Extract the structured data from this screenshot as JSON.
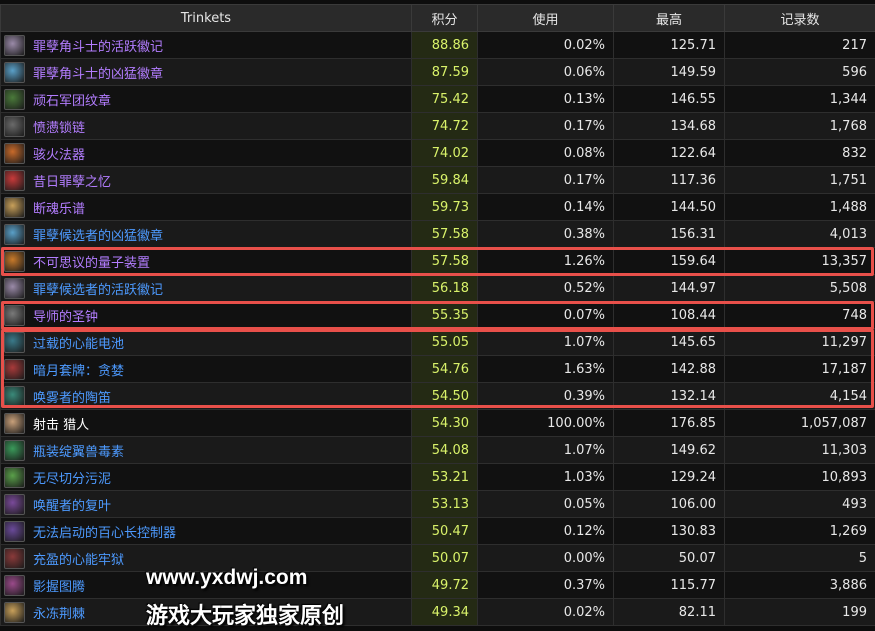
{
  "headers": [
    "Trinkets",
    "积分",
    "使用",
    "最高",
    "记录数"
  ],
  "rows": [
    {
      "name": "罪孽角斗士的活跃徽记",
      "score": "88.86",
      "usage": "0.02%",
      "max": "125.71",
      "records": "217",
      "color": "purple",
      "icon": "gladiator-emblem-icon",
      "icon_color": "#9a8aa8"
    },
    {
      "name": "罪孽角斗士的凶猛徽章",
      "score": "87.59",
      "usage": "0.06%",
      "max": "149.59",
      "records": "596",
      "color": "purple",
      "icon": "gladiator-badge-icon",
      "icon_color": "#5aa0c8"
    },
    {
      "name": "顽石军团纹章",
      "score": "75.42",
      "usage": "0.13%",
      "max": "146.55",
      "records": "1,344",
      "color": "purple",
      "icon": "stone-legion-icon",
      "icon_color": "#4a7a3a"
    },
    {
      "name": "愤懑锁链",
      "score": "74.72",
      "usage": "0.17%",
      "max": "134.68",
      "records": "1,768",
      "color": "purple",
      "icon": "chain-icon",
      "icon_color": "#6a6a6a"
    },
    {
      "name": "骇火法器",
      "score": "74.02",
      "usage": "0.08%",
      "max": "122.64",
      "records": "832",
      "color": "purple",
      "icon": "fire-relic-icon",
      "icon_color": "#c86a2a"
    },
    {
      "name": "昔日罪孽之忆",
      "score": "59.84",
      "usage": "0.17%",
      "max": "117.36",
      "records": "1,751",
      "color": "purple",
      "icon": "memory-icon",
      "icon_color": "#c83a3a"
    },
    {
      "name": "断魂乐谱",
      "score": "59.73",
      "usage": "0.14%",
      "max": "144.50",
      "records": "1,488",
      "color": "purple",
      "icon": "music-sheet-icon",
      "icon_color": "#c8a05a"
    },
    {
      "name": "罪孽候选者的凶猛徽章",
      "score": "57.58",
      "usage": "0.38%",
      "max": "156.31",
      "records": "4,013",
      "color": "blue",
      "icon": "aspirant-badge-icon",
      "icon_color": "#5aa0c8"
    },
    {
      "name": "不可思议的量子装置",
      "score": "57.58",
      "usage": "1.26%",
      "max": "159.64",
      "records": "13,357",
      "color": "purple",
      "icon": "quantum-device-icon",
      "icon_color": "#c87a2a"
    },
    {
      "name": "罪孽候选者的活跃徽记",
      "score": "56.18",
      "usage": "0.52%",
      "max": "144.97",
      "records": "5,508",
      "color": "blue",
      "icon": "aspirant-emblem-icon",
      "icon_color": "#9a8aa8"
    },
    {
      "name": "导师的圣钟",
      "score": "55.35",
      "usage": "0.07%",
      "max": "108.44",
      "records": "748",
      "color": "purple",
      "icon": "bell-icon",
      "icon_color": "#7a7a7a"
    },
    {
      "name": "过载的心能电池",
      "score": "55.05",
      "usage": "1.07%",
      "max": "145.65",
      "records": "11,297",
      "color": "blue",
      "icon": "anima-battery-icon",
      "icon_color": "#3a7a8a"
    },
    {
      "name": "暗月套牌：贪婪",
      "score": "54.76",
      "usage": "1.63%",
      "max": "142.88",
      "records": "17,187",
      "color": "blue",
      "icon": "darkmoon-deck-icon",
      "icon_color": "#a83a3a"
    },
    {
      "name": "唤雾者的陶笛",
      "score": "54.50",
      "usage": "0.39%",
      "max": "132.14",
      "records": "4,154",
      "color": "blue",
      "icon": "ocarina-icon",
      "icon_color": "#3a8a7a"
    },
    {
      "name": "射击 猎人",
      "score": "54.30",
      "usage": "100.00%",
      "max": "176.85",
      "records": "1,057,087",
      "color": "white",
      "icon": "hunter-icon",
      "icon_color": "#c8a07a"
    },
    {
      "name": "瓶装绽翼兽毒素",
      "score": "54.08",
      "usage": "1.07%",
      "max": "149.62",
      "records": "11,303",
      "color": "blue",
      "icon": "venom-bottle-icon",
      "icon_color": "#3a9a5a"
    },
    {
      "name": "无尽切分污泥",
      "score": "53.21",
      "usage": "1.03%",
      "max": "129.24",
      "records": "10,893",
      "color": "blue",
      "icon": "ooze-icon",
      "icon_color": "#5aa04a"
    },
    {
      "name": "唤醒者的复叶",
      "score": "53.13",
      "usage": "0.05%",
      "max": "106.00",
      "records": "493",
      "color": "blue",
      "icon": "leaf-icon",
      "icon_color": "#7a4a9a"
    },
    {
      "name": "无法启动的百心长控制器",
      "score": "50.47",
      "usage": "0.12%",
      "max": "130.83",
      "records": "1,269",
      "color": "blue",
      "icon": "controller-icon",
      "icon_color": "#6a4a9a"
    },
    {
      "name": "充盈的心能牢狱",
      "score": "50.07",
      "usage": "0.00%",
      "max": "50.07",
      "records": "5",
      "color": "blue",
      "icon": "anima-prison-icon",
      "icon_color": "#8a3a3a"
    },
    {
      "name": "影握图腾",
      "score": "49.72",
      "usage": "0.37%",
      "max": "115.77",
      "records": "3,886",
      "color": "blue",
      "icon": "totem-icon",
      "icon_color": "#9a4a8a"
    },
    {
      "name": "永冻荆棘",
      "score": "49.34",
      "usage": "0.02%",
      "max": "82.11",
      "records": "199",
      "color": "blue",
      "icon": "frost-thorn-icon",
      "icon_color": "#c8a05a"
    }
  ],
  "watermark": {
    "url": "www.yxdwj.com",
    "text": "游戏大玩家独家原创"
  },
  "colors": {
    "purple": "#b37dff",
    "blue": "#4d9aff",
    "score": "#d9f26a",
    "highlight": "#e8504a"
  }
}
